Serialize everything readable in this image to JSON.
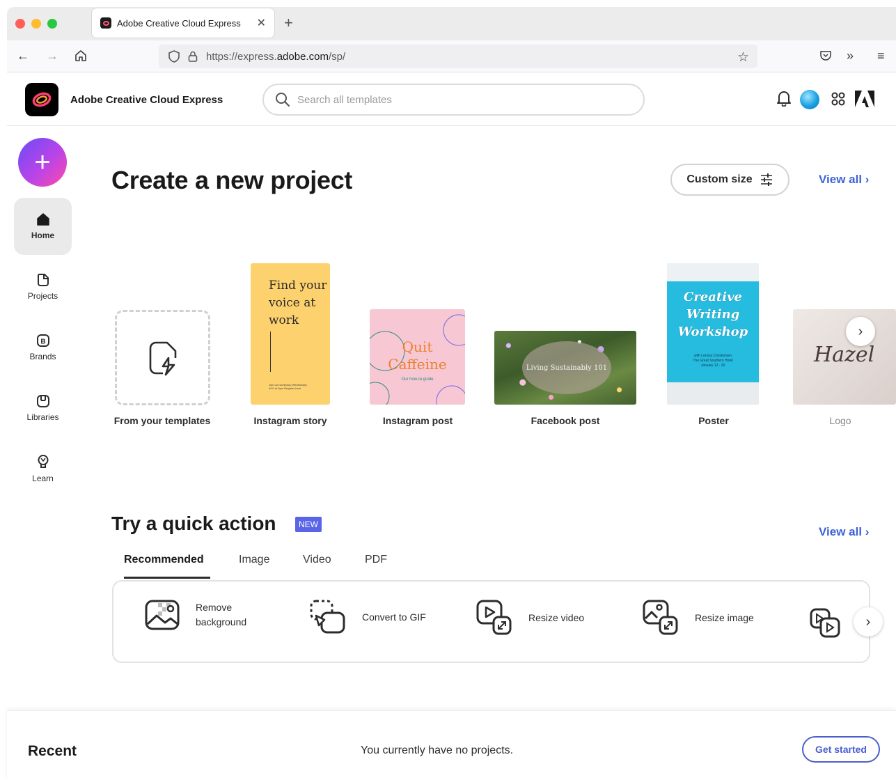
{
  "browser": {
    "tab_title": "Adobe Creative Cloud Express",
    "url_prefix": "https://express.",
    "url_domain": "adobe.com",
    "url_path": "/sp/"
  },
  "app": {
    "name": "Adobe Creative Cloud Express",
    "search_placeholder": "Search all templates"
  },
  "sidebar": {
    "items": [
      {
        "label": "Home",
        "icon": "home-icon",
        "active": true
      },
      {
        "label": "Projects",
        "icon": "projects-icon"
      },
      {
        "label": "Brands",
        "icon": "brands-icon"
      },
      {
        "label": "Libraries",
        "icon": "libraries-icon"
      },
      {
        "label": "Learn",
        "icon": "lightbulb-icon"
      }
    ]
  },
  "create": {
    "title": "Create a new project",
    "custom_size": "Custom size",
    "view_all": "View all",
    "templates": [
      {
        "label": "From your templates"
      },
      {
        "label": "Instagram story",
        "preview_lines": [
          "Find your",
          "voice at",
          "work"
        ],
        "preview_small": "Join our workshop Wednesday 4/10 at 5pm Register here"
      },
      {
        "label": "Instagram post",
        "preview_title_1": "Quit",
        "preview_title_2": "Caffeine",
        "preview_sub": "Our how-to guide"
      },
      {
        "label": "Facebook post",
        "preview_text": "Living Sustainably 101"
      },
      {
        "label": "Poster",
        "preview_lines": [
          "Creative",
          "Writing",
          "Workshop"
        ],
        "preview_small_1": "with Lenora Christensen",
        "preview_small_2": "The Great Southern Hotel",
        "preview_small_3": "January 12 - 20"
      },
      {
        "label": "Logo",
        "preview_text": "Hazel"
      }
    ]
  },
  "quick": {
    "title": "Try a quick action",
    "badge": "NEW",
    "view_all": "View all",
    "tabs": [
      "Recommended",
      "Image",
      "Video",
      "PDF"
    ],
    "actions": [
      {
        "label_1": "Remove",
        "label_2": "background",
        "icon": "remove-background-icon"
      },
      {
        "label": "Convert to GIF",
        "icon": "convert-gif-icon"
      },
      {
        "label": "Resize video",
        "icon": "resize-video-icon"
      },
      {
        "label": "Resize image",
        "icon": "resize-image-icon"
      }
    ]
  },
  "recent": {
    "title": "Recent",
    "message": "You currently have no projects.",
    "button": "Get started"
  }
}
